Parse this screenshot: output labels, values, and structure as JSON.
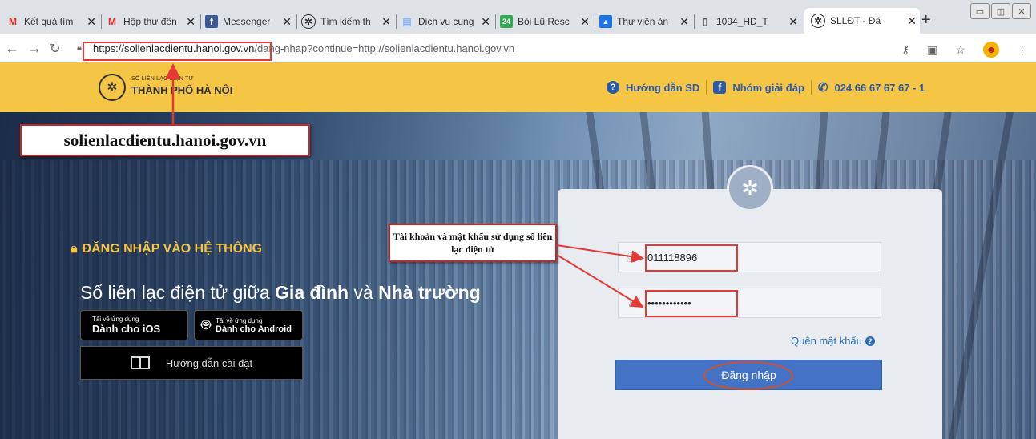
{
  "browser": {
    "tabs": [
      {
        "title": "Kết quả tìm",
        "favicon": "gmail-icon"
      },
      {
        "title": "Hộp thư đến",
        "favicon": "gmail-icon"
      },
      {
        "title": "Messenger",
        "favicon": "facebook-icon"
      },
      {
        "title": "Tìm kiếm th",
        "favicon": "hanoi-emblem-icon"
      },
      {
        "title": "Dịch vụ cụng",
        "favicon": "document-icon"
      },
      {
        "title": "Bói Lũ Resc",
        "favicon": "app-24-icon"
      },
      {
        "title": "Thư viện ản",
        "favicon": "image-library-icon"
      },
      {
        "title": "1094_HD_T",
        "favicon": "file-icon"
      },
      {
        "title": "SLLĐT - Đă",
        "favicon": "hanoi-emblem-icon",
        "active": true
      }
    ],
    "url_host": "https://solienlacdientu.hanoi.gov.vn",
    "url_path": "/dang-nhap?continue=http://solienlacdientu.hanoi.gov.vn"
  },
  "header": {
    "logo_small": "SỔ LIÊN LẠC ĐIỆN TỬ",
    "logo_big": "THÀNH PHỐ HÀ NỘI",
    "guide_link": "Hướng dẫn SD",
    "group_link": "Nhóm giải đáp",
    "phone": "024 66 67 67 67 - 1"
  },
  "annotations": {
    "site_label": "solienlacdientu.hanoi.gov.vn",
    "account_note": "Tài khoản và mật khẩu sử dụng sổ liên lạc điện tử"
  },
  "hero": {
    "login_title": "ĐĂNG NHẬP VÀO HỆ THỐNG",
    "tagline_pre": "Sổ liên lạc điện tử giữa ",
    "tagline_b1": "Gia đình",
    "tagline_mid": " và ",
    "tagline_b2": "Nhà trường",
    "ios_small": "Tải về ứng dụng",
    "ios_big": "Dành cho iOS",
    "android_small": "Tải về ứng dụng",
    "android_big": "Dành cho Android",
    "install_guide": "Hướng dẫn cài đặt"
  },
  "login": {
    "username_value": "011118896",
    "password_value": "••••••••••••",
    "forgot": "Quên mật khẩu",
    "submit": "Đăng nhập"
  },
  "colors": {
    "header": "#f5c546",
    "accent": "#4472c4",
    "annotation": "#e53935"
  }
}
